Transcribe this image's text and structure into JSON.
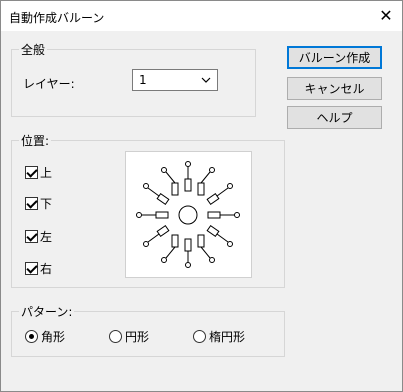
{
  "window": {
    "title": "自動作成バルーン"
  },
  "group_general": {
    "legend": "全般",
    "layer_label": "レイヤー:",
    "layer_value": "1"
  },
  "group_position": {
    "legend": "位置:",
    "checks": [
      {
        "label": "上",
        "checked": true
      },
      {
        "label": "下",
        "checked": true
      },
      {
        "label": "左",
        "checked": true
      },
      {
        "label": "右",
        "checked": true
      }
    ]
  },
  "group_pattern": {
    "legend": "パターン:",
    "options": [
      {
        "label": "角形",
        "selected": true
      },
      {
        "label": "円形",
        "selected": false
      },
      {
        "label": "楕円形",
        "selected": false
      }
    ]
  },
  "buttons": {
    "create": "バルーン作成",
    "cancel": "キャンセル",
    "help": "ヘルプ"
  },
  "icons": {
    "close": "close-icon",
    "dropdown": "chevron-down-icon"
  },
  "colors": {
    "accent": "#0078d7",
    "window_bg": "#f0f0f0",
    "title_bg": "#ffffff"
  }
}
